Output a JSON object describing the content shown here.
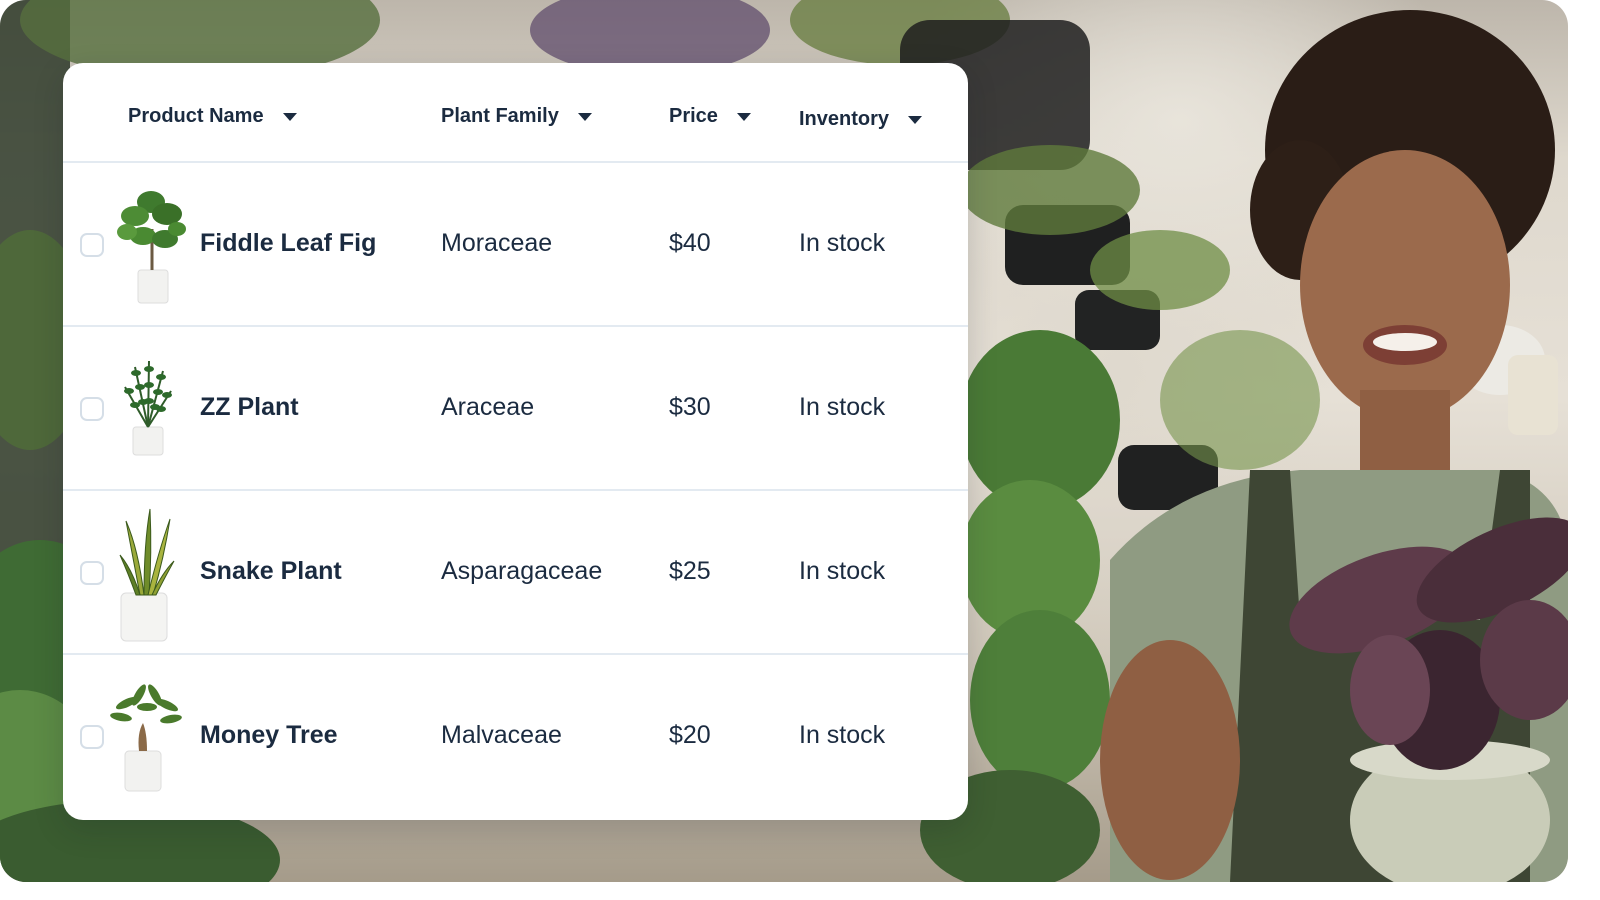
{
  "table": {
    "columns": [
      {
        "label": "Product Name",
        "icon": "caret-down-icon"
      },
      {
        "label": "Plant Family",
        "icon": "caret-down-icon"
      },
      {
        "label": "Price",
        "icon": "caret-down-icon"
      },
      {
        "label": "Inventory",
        "icon": "caret-down-icon"
      }
    ],
    "rows": [
      {
        "name": "Fiddle Leaf Fig",
        "family": "Moraceae",
        "price": "$40",
        "inventory": "In stock",
        "thumb_icon": "fiddle-leaf-fig-plant-icon"
      },
      {
        "name": "ZZ Plant",
        "family": "Araceae",
        "price": "$30",
        "inventory": "In stock",
        "thumb_icon": "zz-plant-icon"
      },
      {
        "name": "Snake Plant",
        "family": "Asparagaceae",
        "price": "$25",
        "inventory": "In stock",
        "thumb_icon": "snake-plant-icon"
      },
      {
        "name": "Money Tree",
        "family": "Malvaceae",
        "price": "$20",
        "inventory": "In stock",
        "thumb_icon": "money-tree-plant-icon"
      }
    ]
  },
  "colors": {
    "text": "#1b2b40",
    "divider": "#e3eaf1",
    "checkbox_border": "#d5dee7",
    "card_bg": "#ffffff"
  }
}
